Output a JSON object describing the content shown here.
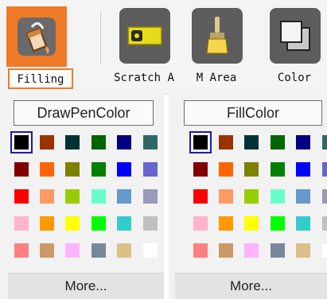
{
  "toolbar": {
    "tools": [
      {
        "label": "Filling",
        "icon": "paint-bucket-icon",
        "active": true
      },
      {
        "label": "Scratch A",
        "icon": "eraser-icon",
        "active": false
      },
      {
        "label": "M Area",
        "icon": "brush-icon",
        "active": false
      },
      {
        "label": "Color",
        "icon": "color-icon",
        "active": false
      }
    ]
  },
  "panels": [
    {
      "button_label": "DrawPenColor",
      "more_label": "More...",
      "selected_index": 0
    },
    {
      "button_label": "FillColor",
      "more_label": "More...",
      "selected_index": 0
    }
  ],
  "palette": [
    "#000000",
    "#993300",
    "#003333",
    "#006600",
    "#000080",
    "#336666",
    "#800000",
    "#ff6600",
    "#808000",
    "#008000",
    "#0000ff",
    "#6666cc",
    "#ff0000",
    "#ff9966",
    "#99cc00",
    "#66ffcc",
    "#6699cc",
    "#9999bb",
    "#ffb3cc",
    "#ff9900",
    "#ffff00",
    "#00ff00",
    "#33cccc",
    "#c0c0c0",
    "#ff7f7f",
    "#cc9966",
    "#ffb3ff",
    "#778899",
    "#ddc088",
    "#ffffff"
  ],
  "colors": {
    "accent": "#ef7a28",
    "selection": "#1b1bb0"
  }
}
